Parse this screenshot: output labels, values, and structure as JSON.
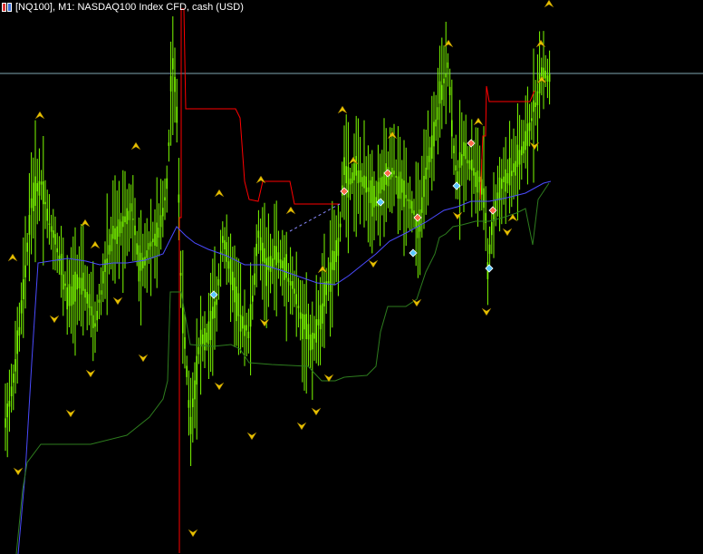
{
  "window": {
    "title": "[NQ100], M1:  NASDAQ100 Index CFD, cash (USD)",
    "icon": "chart-window-icon"
  },
  "colors": {
    "background": "#000000",
    "candle": "#7CFC00",
    "upper_band": "#ff0000",
    "lower_band": "#2e7d1e",
    "moving_average": "#4b4bff",
    "price_line": "#7fa6b0",
    "arrow_up": "#e8c000",
    "arrow_down": "#e8c000",
    "marker_buy": "#5ac8ff",
    "marker_sell": "#ff6a4a"
  },
  "chart_data": {
    "type": "candlestick",
    "symbol": "NQ100",
    "timeframe": "M1",
    "description": "NASDAQ100 Index CFD, cash (USD)",
    "price_axis_visible": false,
    "time_axis_visible": false,
    "grid": false,
    "close_series": [
      260,
      230,
      200,
      180,
      175,
      190,
      170,
      165,
      220,
      230,
      210,
      240,
      260,
      280,
      300,
      290,
      310,
      320,
      300,
      290,
      280,
      300,
      310,
      320,
      330,
      310,
      280,
      260,
      240,
      220,
      230,
      210,
      200,
      220,
      240,
      260,
      280,
      270,
      250,
      230,
      210,
      190,
      170,
      160,
      150,
      140,
      180,
      220,
      260,
      300,
      320,
      310,
      300,
      280,
      270,
      260,
      240,
      220,
      210,
      200,
      210,
      230,
      250,
      270,
      290,
      280,
      300,
      310,
      290,
      280,
      300,
      320,
      340,
      360,
      380,
      400,
      390,
      410,
      420,
      440,
      430,
      420,
      400,
      390,
      380,
      360,
      340,
      320,
      300,
      290,
      280,
      260,
      250,
      240,
      230,
      250,
      270,
      260,
      240,
      230,
      210,
      200,
      190,
      180,
      170,
      150,
      160,
      170,
      180,
      190,
      200,
      210,
      190,
      180,
      170,
      160,
      150,
      140,
      130,
      120,
      110,
      100,
      120,
      140,
      150,
      170,
      160,
      150,
      140,
      130,
      120,
      110,
      90,
      100,
      110,
      120,
      130,
      150,
      170,
      160,
      140,
      120
    ],
    "upper_band": [
      350,
      350,
      350,
      120,
      120,
      120,
      120,
      120,
      120,
      200,
      200,
      200,
      200,
      260,
      260,
      260,
      260,
      260,
      260,
      260,
      260,
      260,
      260,
      260,
      200,
      200,
      200,
      200,
      200,
      200,
      200,
      200,
      200,
      200,
      200,
      160,
      160,
      160,
      160,
      160,
      160,
      160,
      160,
      160,
      160,
      160,
      160,
      160,
      160,
      160,
      160,
      160,
      120,
      120,
      120,
      120,
      120,
      120,
      120,
      120,
      120,
      120,
      120,
      120,
      120,
      120,
      120,
      120,
      120,
      120,
      120
    ],
    "moving_average": [
      230,
      240,
      250,
      260,
      270,
      280,
      300,
      320,
      350,
      380,
      400,
      420,
      440,
      460,
      470,
      480,
      490,
      500,
      510,
      520,
      530,
      540,
      550,
      560,
      570,
      580,
      590,
      600,
      610,
      620,
      630,
      640,
      650,
      660,
      670,
      680,
      690,
      700,
      710,
      720,
      730,
      740,
      750,
      760,
      770,
      780,
      790,
      800,
      810,
      820,
      830
    ],
    "lower_band": [
      100,
      110,
      120,
      130,
      140,
      150,
      160,
      170,
      180,
      190,
      200,
      210,
      220,
      230,
      240,
      250,
      260,
      270,
      280,
      290,
      300,
      310,
      320,
      330,
      340,
      350,
      360,
      370,
      380,
      390,
      400,
      410,
      420,
      430,
      440,
      450,
      460,
      470,
      480,
      490,
      500,
      510,
      520,
      530,
      540,
      550,
      560,
      570,
      580,
      590,
      600
    ],
    "current_price_line": 81,
    "signals": {
      "arrows_up": 14,
      "arrows_down": 18,
      "buy_markers": 5,
      "sell_markers": 5
    }
  }
}
